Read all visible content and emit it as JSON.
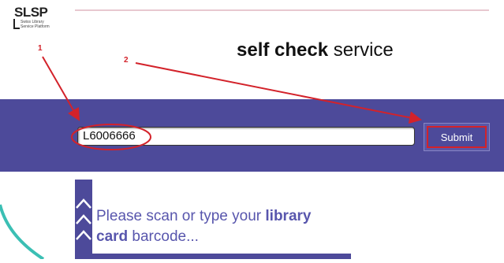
{
  "logo": {
    "name": "SLSP",
    "subtitle_line1": "Swiss Library",
    "subtitle_line2": "Service Platform"
  },
  "header": {
    "title_bold": "self check",
    "title_rest": " service"
  },
  "form": {
    "barcode_value": "L6006666",
    "submit_label": "Submit"
  },
  "info": {
    "text_before": "Please scan or type your ",
    "text_bold1": "library",
    "text_bold2": "card",
    "text_after": " barcode..."
  },
  "annotations": {
    "marker_1": "1",
    "marker_2": "2"
  },
  "colors": {
    "band": "#4d4a9a",
    "accent_text": "#5856ad",
    "annotation": "#d3222a",
    "swoosh": "#3bbfb4"
  }
}
